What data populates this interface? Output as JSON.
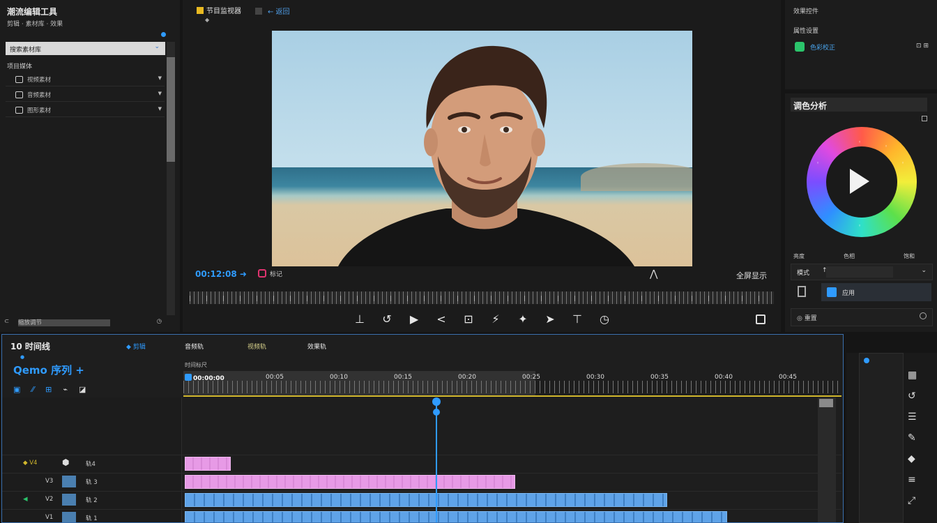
{
  "left_panel": {
    "title": "潮流编辑工具",
    "subtitle": "剪辑 · 素材库 · 效果",
    "search_value": "搜索素材库",
    "section": "项目媒体",
    "rows": [
      {
        "label": "视频素材"
      },
      {
        "label": "音频素材"
      },
      {
        "label": "图形素材"
      }
    ],
    "bottom_label": "缩放调节",
    "bottom_right": "◷"
  },
  "viewer": {
    "title": "节目监视器",
    "title2": "← 返回",
    "sub": "◆",
    "timecode": "00:12:08 ➜",
    "mark_label": "标记",
    "angle_icon": "⋀",
    "right_label": "全屏显示",
    "controls": [
      "⊥",
      "↺",
      "▶",
      "<",
      "⊡",
      "⚡",
      "✦",
      "➤",
      "⊤",
      "◷"
    ]
  },
  "right_top": {
    "a": "效果控件",
    "b": "属性设置",
    "c": "色彩校正",
    "d": "⊡ ⊞"
  },
  "color_panel": {
    "header": "调色分析",
    "labels": [
      "亮度",
      "色相",
      "饱和"
    ],
    "select_label": "模式",
    "select_value": "↑",
    "select_chevron": "⌄",
    "button_label": "应用",
    "footer": "◎ 重置"
  },
  "timeline": {
    "name": "10 时间线",
    "sub": "●",
    "sequence": "Qemo 序列 +",
    "tabs": [
      "◆ 剪辑",
      "音频轨",
      "视频轨",
      "效果轨"
    ],
    "ruler_label": "时间标尺",
    "ticks": [
      "00:00:00",
      "00:05",
      "00:10",
      "00:15",
      "00:20",
      "00:25",
      "00:30",
      "00:35",
      "00:40",
      "00:45"
    ],
    "tracks": [
      {
        "a": "◆ V4",
        "t": "⬢",
        "n": "轨4"
      },
      {
        "a": "",
        "t": "V3",
        "n": "轨 3"
      },
      {
        "a": "◀",
        "t": "V2",
        "n": "轨 2"
      },
      {
        "a": "",
        "t": "V1",
        "n": "轨 1"
      }
    ]
  },
  "colors": {
    "accent": "#2f9bff",
    "pink_clip": "#e79ae6",
    "blue_clip": "#5fa3e8",
    "playhead": "#2f9bff"
  }
}
